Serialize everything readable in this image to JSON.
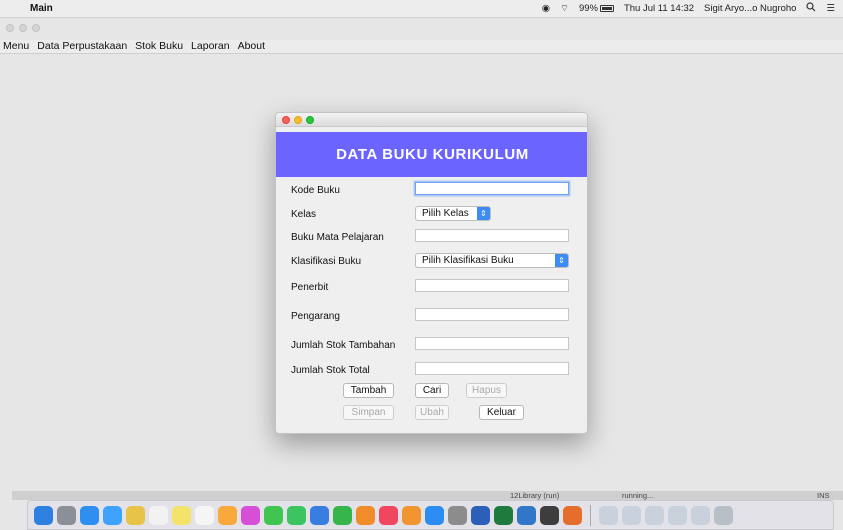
{
  "menubar": {
    "app_name": "Main",
    "battery": "99%",
    "datetime": "Thu Jul 11  14:32",
    "user": "Sigit Aryo...o Nugroho"
  },
  "app_menu": {
    "items": [
      "Menu",
      "Data Perpustakaan",
      "Stok Buku",
      "Laporan",
      "About"
    ]
  },
  "dialog": {
    "title": "DATA BUKU KURIKULUM",
    "labels": {
      "kode_buku": "Kode Buku",
      "kelas": "Kelas",
      "mata_pelajaran": "Buku Mata Pelajaran",
      "klasifikasi": "Klasifikasi Buku",
      "penerbit": "Penerbit",
      "pengarang": "Pengarang",
      "stok_tambahan": "Jumlah Stok Tambahan",
      "stok_total": "Jumlah Stok Total"
    },
    "fields": {
      "kode_buku": "",
      "mata_pelajaran": "",
      "penerbit": "",
      "pengarang": "",
      "stok_tambahan": "",
      "stok_total": ""
    },
    "selects": {
      "kelas": "Pilih Kelas",
      "klasifikasi": "Pilih Klasifikasi Buku"
    },
    "buttons": {
      "tambah": "Tambah",
      "cari": "Cari",
      "hapus": "Hapus",
      "simpan": "Simpan",
      "ubah": "Ubah",
      "keluar": "Keluar"
    }
  },
  "statusbar": {
    "project": "12Library (run)",
    "state": "running...",
    "mode": "INS"
  },
  "dock": {
    "icons": [
      "finder-icon",
      "launchpad-icon",
      "safari-icon",
      "preview-icon",
      "notes-icon",
      "calendar-icon",
      "stickies-icon",
      "reminders-icon",
      "photos-icon",
      "itunes-icon",
      "messages-icon",
      "facetime-icon",
      "keynote-icon",
      "numbers-icon",
      "pages-icon",
      "music-icon",
      "ibooks-icon",
      "appstore-icon",
      "system-prefs-icon",
      "word-icon",
      "excel-icon",
      "virtualbox-icon",
      "quicktime-icon",
      "java-icon",
      "window-thumb-1",
      "window-thumb-2",
      "window-thumb-3",
      "window-thumb-4",
      "window-thumb-5",
      "trash-icon"
    ],
    "colors": [
      "#2d7fe0",
      "#8a8f98",
      "#2f8ff0",
      "#3fa2ff",
      "#e8c34a",
      "#f2f2f2",
      "#f4e36b",
      "#f5f5f5",
      "#f9a93b",
      "#d84fd7",
      "#40c550",
      "#3bc45f",
      "#3a7de0",
      "#36b54a",
      "#f08c2a",
      "#f04660",
      "#f19530",
      "#2d8cf3",
      "#8c8c8c",
      "#2b5fb8",
      "#1f7a3d",
      "#3176c9",
      "#3d3d3d",
      "#e66e2c",
      "#c9d1dc",
      "#c9d1dc",
      "#c9d1dc",
      "#c9d1dc",
      "#c9d1dc",
      "#b8bfc7"
    ]
  }
}
